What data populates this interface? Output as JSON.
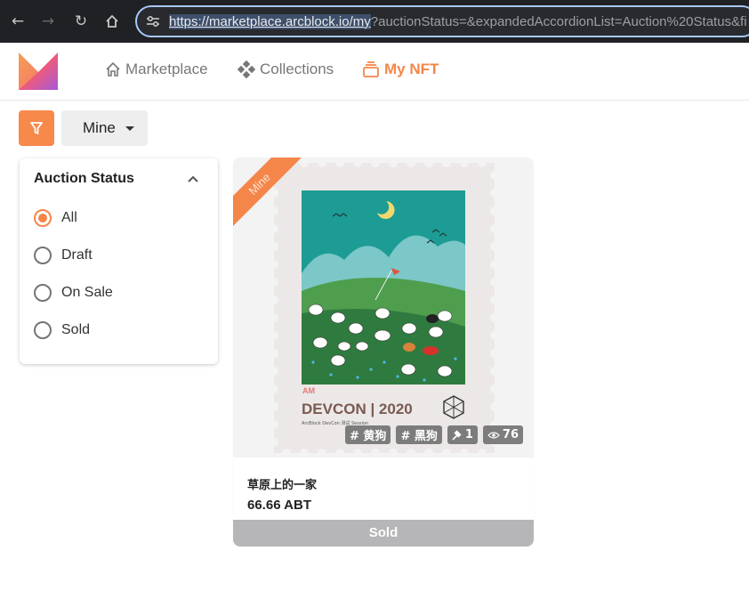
{
  "browser": {
    "url_host": "https://marketplace.arcblock.io/my",
    "url_rest": "?auctionStatus=&expandedAccordionList=Auction%20Status&fi"
  },
  "header": {
    "nav": [
      {
        "label": "Marketplace",
        "icon": "home-icon"
      },
      {
        "label": "Collections",
        "icon": "collections-icon"
      },
      {
        "label": "My NFT",
        "icon": "layers-icon",
        "active": true
      }
    ]
  },
  "toolbar": {
    "filter_icon": "filter-icon",
    "owner_select": "Mine"
  },
  "filters": {
    "title": "Auction Status",
    "options": [
      {
        "label": "All",
        "checked": true
      },
      {
        "label": "Draft",
        "checked": false
      },
      {
        "label": "On Sale",
        "checked": false
      },
      {
        "label": "Sold",
        "checked": false
      }
    ]
  },
  "nft_card": {
    "ribbon": "Mine",
    "stamp_title": "DEVCON | 2020",
    "stamp_subtitle": "ArcBlock DevCon 测试 Session",
    "stamp_logo": "AM",
    "tags": [
      "# 黄狗",
      "# 黑狗"
    ],
    "bids": "1",
    "views": "76",
    "name": "草原上的一家",
    "price": "66.66 ABT",
    "status": "Sold"
  },
  "colors": {
    "accent": "#f4864a",
    "browser_bg": "#202124",
    "status_sold": "#b6b6b9"
  }
}
